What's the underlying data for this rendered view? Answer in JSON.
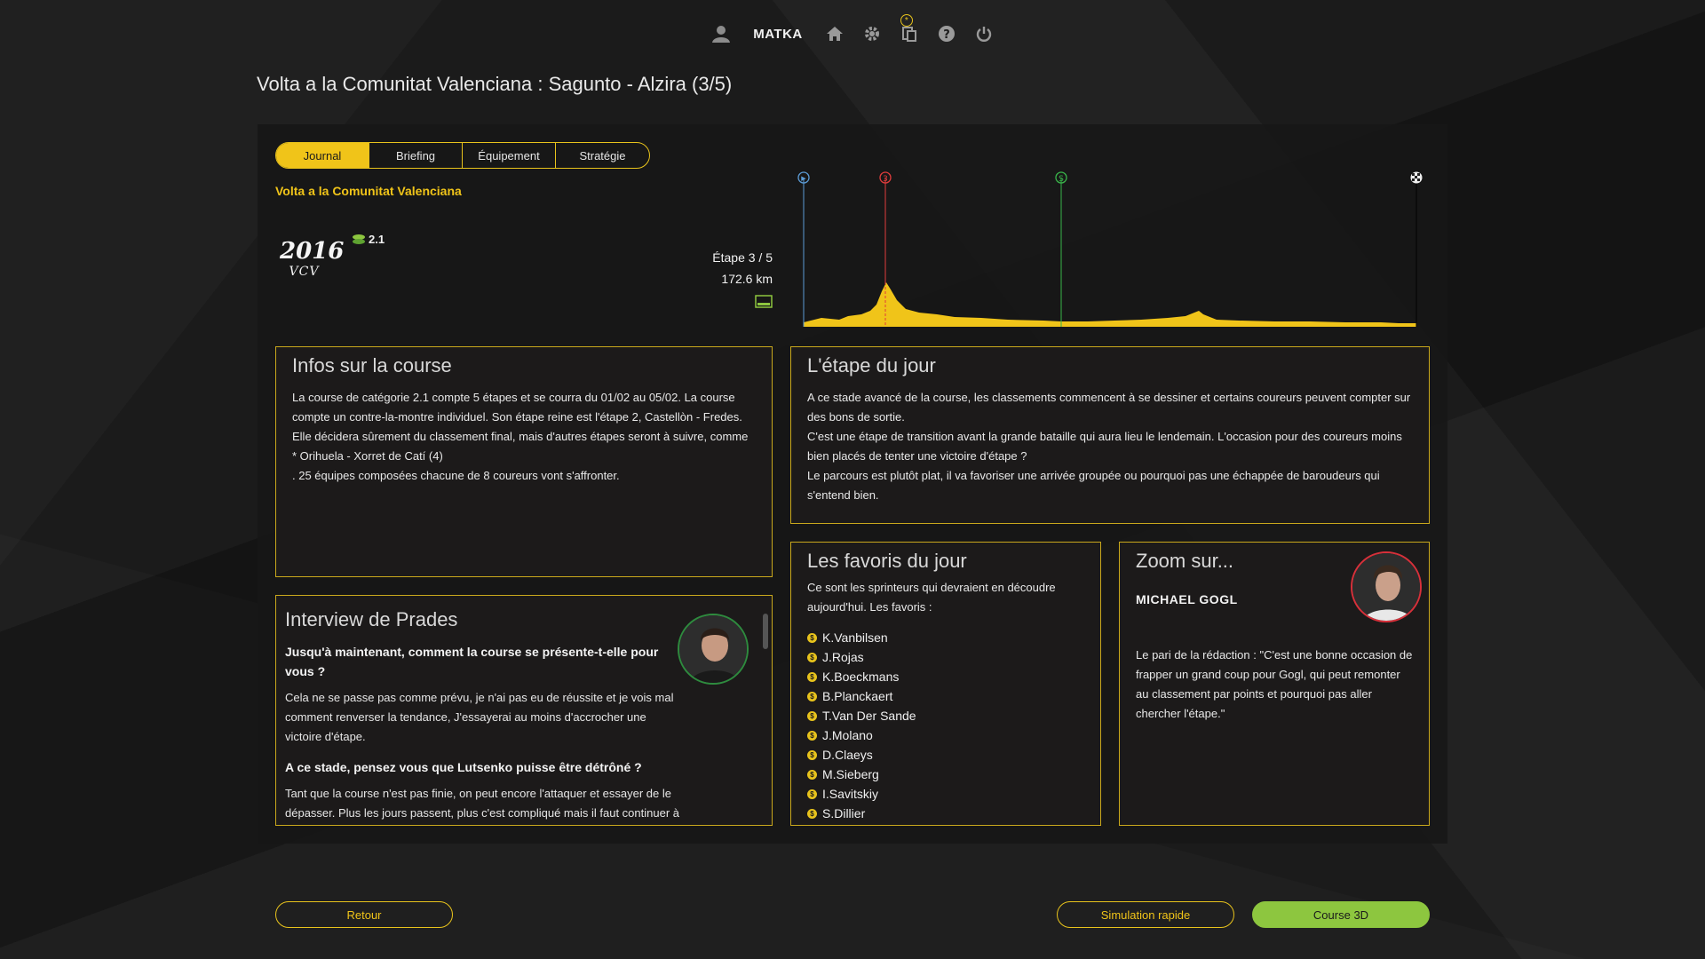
{
  "topbar": {
    "username": "MATKA"
  },
  "title": "Volta a la Comunitat Valenciana : Sagunto - Alzira (3/5)",
  "tabs": [
    {
      "label": "Journal",
      "active": true
    },
    {
      "label": "Briefing",
      "active": false
    },
    {
      "label": "Équipement",
      "active": false
    },
    {
      "label": "Stratégie",
      "active": false
    }
  ],
  "race": {
    "name": "Volta a la Comunitat Valenciana",
    "logo_year": "2016",
    "logo_abbr": "VCV",
    "category": "2.1",
    "stage": "Étape 3 / 5",
    "distance": "172.6 km",
    "profile": {
      "start_marker": "▶",
      "climb_marker": "3",
      "sprint_marker": "S",
      "finish_marker": "checkered-flag-icon",
      "colors": {
        "fill": "#f0c419",
        "start": "#5b9bd5",
        "climb": "#e03c3c",
        "sprint": "#39b54a"
      }
    }
  },
  "infos": {
    "title": "Infos sur la course",
    "lines": [
      "La course de catégorie 2.1 compte 5 étapes et se courra du 01/02 au 05/02. La course compte un contre-la-montre individuel. Son étape reine est l'étape 2, Castellòn - Fredes. Elle décidera sûrement du classement final, mais d'autres étapes seront à suivre, comme",
      " * Orihuela - Xorret de Catí (4)",
      ". 25 équipes composées chacune de 8 coureurs vont s'affronter."
    ]
  },
  "etape": {
    "title": "L'étape du jour",
    "lines": [
      "A ce stade avancé de la course, les classements commencent à se dessiner et certains coureurs peuvent compter sur des bons de sortie.",
      "C'est une étape de transition avant la grande bataille qui aura lieu le lendemain. L'occasion pour des coureurs moins bien placés de tenter une victoire d'étape ?",
      "Le parcours est plutôt plat, il va favoriser une arrivée groupée ou pourquoi pas une échappée de baroudeurs qui s'entend bien."
    ]
  },
  "interview": {
    "title": "Interview de Prades",
    "q1": "Jusqu'à maintenant, comment la course se présente-t-elle pour vous ?",
    "a1": "Cela ne se passe pas comme prévu, je n'ai pas eu de réussite et je vois mal comment renverser la tendance, J'essayerai au moins d'accrocher une victoire d'étape.",
    "q2": "A ce stade, pensez vous que Lutsenko puisse être détrôné ?",
    "a2": "Tant que la course n'est pas finie, on peut encore l'attaquer et essayer de le dépasser. Plus les jours passent, plus c'est compliqué mais il faut continuer à se battre."
  },
  "favoris": {
    "title": "Les favoris du jour",
    "intro": "Ce sont les sprinteurs qui devraient en découdre aujourd'hui. Les favoris :",
    "riders": [
      "K.Vanbilsen",
      "J.Rojas",
      "K.Boeckmans",
      "B.Planckaert",
      "T.Van Der Sande",
      "J.Molano",
      "D.Claeys",
      "M.Sieberg",
      "I.Savitskiy",
      "S.Dillier"
    ]
  },
  "zoom": {
    "title": "Zoom sur...",
    "rider": "MICHAEL GOGL",
    "text": "Le pari de la rédaction : \"C'est une bonne occasion de frapper un grand coup pour Gogl, qui peut remonter au classement par points et pourquoi pas aller chercher l'étape.\""
  },
  "buttons": {
    "retour": "Retour",
    "simulation": "Simulation rapide",
    "course3d": "Course 3D"
  }
}
